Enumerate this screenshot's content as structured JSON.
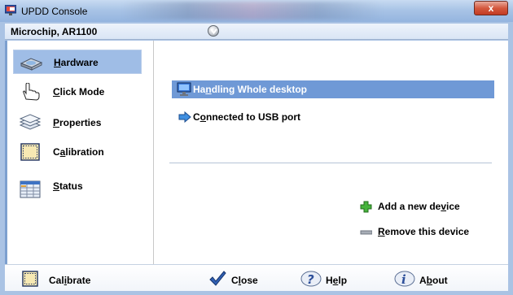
{
  "window": {
    "title": "UPDD Console",
    "close_glyph": "x"
  },
  "device": {
    "name": "Microchip, AR1100",
    "dropdown_icon": "chevron-down-icon"
  },
  "nav": [
    {
      "label_pre": "",
      "label_u": "H",
      "label_post": "ardware",
      "icon": "hardware-icon",
      "active": true
    },
    {
      "label_pre": "",
      "label_u": "C",
      "label_post": "lick Mode",
      "icon": "hand-pointer-icon",
      "active": false
    },
    {
      "label_pre": "",
      "label_u": "P",
      "label_post": "roperties",
      "icon": "layers-icon",
      "active": false
    },
    {
      "label_pre": "C",
      "label_u": "a",
      "label_post": "libration",
      "icon": "calibration-icon",
      "active": false
    },
    {
      "label_pre": "",
      "label_u": "S",
      "label_post": "tatus",
      "icon": "status-grid-icon",
      "active": false
    }
  ],
  "hardware": {
    "desktop_row": {
      "label_pre": "Ha",
      "label_u": "n",
      "label_post": "dling Whole desktop",
      "icon": "monitor-icon"
    },
    "port_row": {
      "label_pre": "C",
      "label_u": "o",
      "label_post": "nnected to USB port",
      "icon": "arrow-right-icon"
    },
    "add_device": {
      "label_pre": "Add a new de",
      "label_u": "v",
      "label_post": "ice",
      "icon": "plus-icon"
    },
    "remove_device": {
      "label_pre": "",
      "label_u": "R",
      "label_post": "emove this device",
      "icon": "minus-icon"
    }
  },
  "bottom": {
    "calibrate": {
      "label_pre": "Cal",
      "label_u": "i",
      "label_post": "brate",
      "icon": "calibration-icon"
    },
    "close": {
      "label_pre": "C",
      "label_u": "l",
      "label_post": "ose",
      "icon": "checkmark-icon"
    },
    "help": {
      "label_pre": "H",
      "label_u": "e",
      "label_post": "lp",
      "icon": "help-icon"
    },
    "about": {
      "label_pre": "A",
      "label_u": "b",
      "label_post": "out",
      "icon": "info-icon"
    }
  },
  "colors": {
    "selection": "#6f99d6",
    "nav_active": "#9fbde6",
    "frame": "#aac3e4"
  }
}
